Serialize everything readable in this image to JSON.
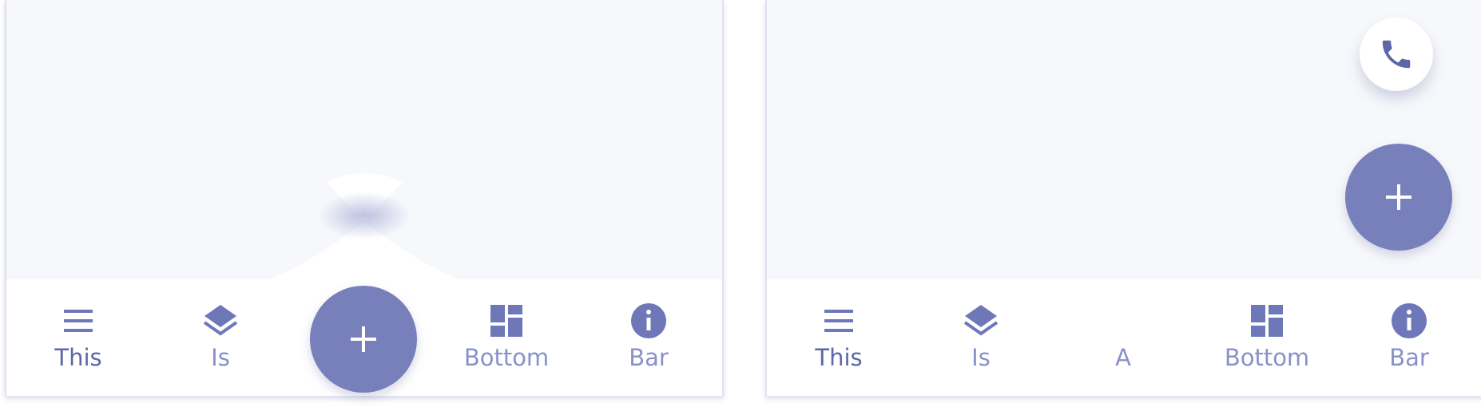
{
  "left_panel": {
    "nav_items": [
      {
        "label": "This",
        "icon": "menu-icon",
        "active": true
      },
      {
        "label": "Is",
        "icon": "layers-icon",
        "active": false
      },
      {
        "label": "Bottom",
        "icon": "dashboard-icon",
        "active": false
      },
      {
        "label": "Bar",
        "icon": "info-icon",
        "active": false
      }
    ],
    "center_fab": {
      "icon": "plus-icon"
    }
  },
  "right_panel": {
    "nav_items": [
      {
        "label": "This",
        "icon": "menu-icon",
        "active": true
      },
      {
        "label": "Is",
        "icon": "layers-icon",
        "active": false
      },
      {
        "label": "A",
        "icon": "",
        "active": false
      },
      {
        "label": "Bottom",
        "icon": "dashboard-icon",
        "active": false
      },
      {
        "label": "Bar",
        "icon": "info-icon",
        "active": false
      }
    ],
    "fab": {
      "icon": "plus-icon"
    },
    "mini_fab": {
      "icon": "phone-icon"
    }
  },
  "colors": {
    "accent": "#7880bc",
    "icon": "#6e78b9",
    "label": "#8891c9",
    "label_active": "#5c67a8",
    "surface": "#f7f8fb"
  }
}
